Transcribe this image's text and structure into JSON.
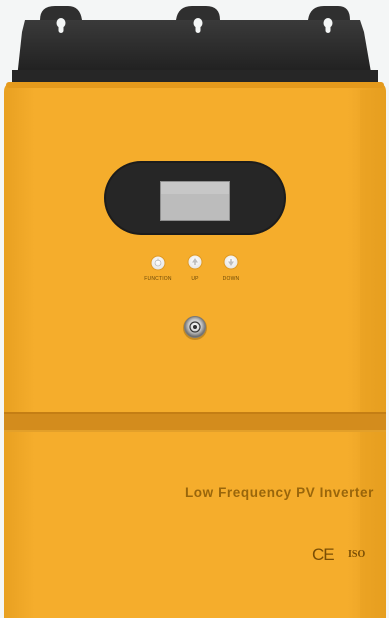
{
  "product": {
    "name": "Low Frequency PV Inverter",
    "button_labels": {
      "function": "FUNCTION",
      "up": "UP",
      "down": "DOWN"
    },
    "certifications": {
      "ce": "CE",
      "iso": "ISO"
    }
  },
  "colors": {
    "body": "#f3a92a",
    "body_shadow": "#d98f14",
    "band": "#d18b1b",
    "bracket": "#2b2b2b",
    "display_bezel": "#1f1f1f",
    "screen": "#bfbfbf",
    "background": "#f4f6f6"
  }
}
